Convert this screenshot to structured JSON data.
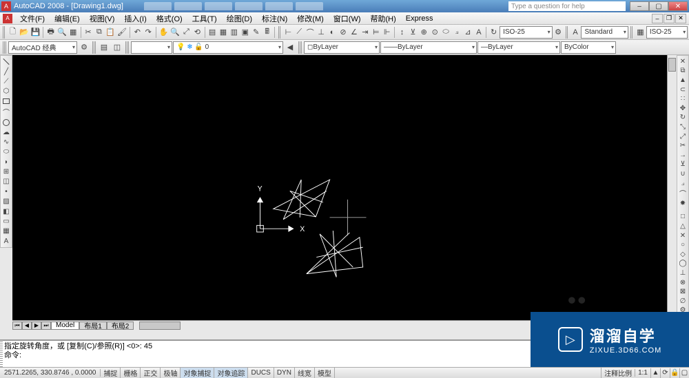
{
  "titlebar": {
    "app_title": "AutoCAD 2008 - [Drawing1.dwg]",
    "help_placeholder": "Type a question for help"
  },
  "menubar": {
    "items": [
      "文件(F)",
      "编辑(E)",
      "视图(V)",
      "插入(I)",
      "格式(O)",
      "工具(T)",
      "绘图(D)",
      "标注(N)",
      "修改(M)",
      "窗口(W)",
      "帮助(H)",
      "Express"
    ]
  },
  "toolbar1": {
    "workspace": "AutoCAD 经典",
    "layer_state": "",
    "layer": "0",
    "linetype": "ByLayer",
    "lineweight": "ByLayer",
    "color": "ByColor",
    "dimstyle": "ISO-25",
    "textstyle": "Standard",
    "tablestyle": "ISO-25"
  },
  "statusbar": {
    "coords": "2571.2265, 330.8746 , 0.0000",
    "snap": "捕捉",
    "grid": "栅格",
    "ortho": "正交",
    "polar": "极轴",
    "osnap": "对象捕捉",
    "otrack": "对象追踪",
    "ducs": "DUCS",
    "dyn": "DYN",
    "lwt": "线宽",
    "model": "模型",
    "annoscale_label": "注释比例",
    "annoscale_value": "1:1"
  },
  "modeltabs": {
    "model": "Model",
    "layout1": "布局1",
    "layout2": "布局2"
  },
  "command": {
    "line1": "指定旋转角度，或 [复制(C)/参照(R)] <0>:   45",
    "line2": "命令:"
  },
  "watermark": {
    "brand": "溜溜自学",
    "url": "ZIXUE.3D66.COM"
  },
  "drawing": {
    "ucs_x": "X",
    "ucs_y": "Y"
  }
}
